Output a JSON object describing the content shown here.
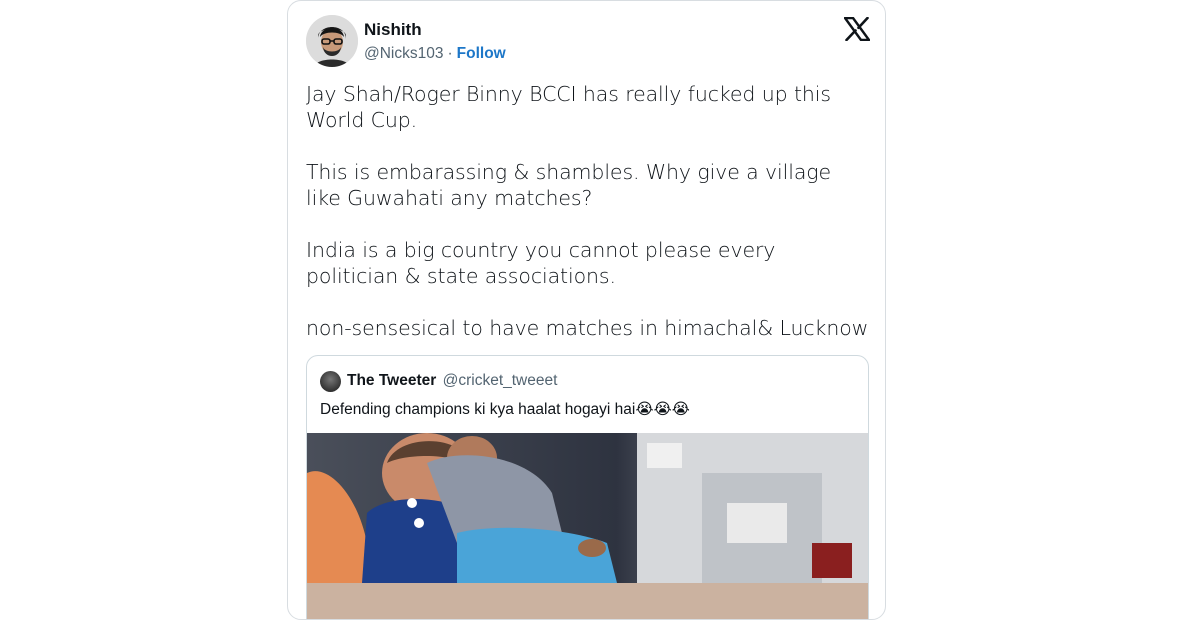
{
  "tweet": {
    "author_name": "Nishith",
    "author_handle": "@Nicks103",
    "separator": "·",
    "follow_label": "Follow",
    "paragraphs": [
      "Jay Shah/Roger Binny BCCI has really fucked up this World Cup.",
      "This is embarassing & shambles. Why give a village like Guwahati any matches?",
      "India is a big country you cannot please every politician & state associations.",
      "non-sensesical to have matches in himachal& Lucknow"
    ]
  },
  "quoted": {
    "author_name": "The Tweeter",
    "author_handle": "@cricket_tweeet",
    "text": "Defending champions ki kya haalat hogayi hai😭😭😭"
  },
  "icons": {
    "platform_logo": "x-logo-icon",
    "avatar": "avatar",
    "quoted_avatar": "quoted-avatar"
  },
  "colors": {
    "link": "#1d77c8",
    "text": "#0f1419",
    "secondary": "#536471",
    "border": "#cfd9de"
  }
}
